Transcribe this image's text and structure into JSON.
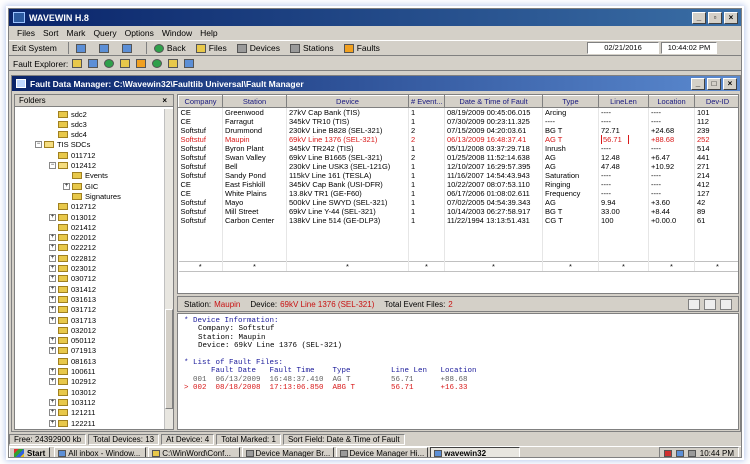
{
  "app": {
    "title": "WAVEWIN H.8"
  },
  "menu": [
    "Files",
    "Sort",
    "Mark",
    "Query",
    "Options",
    "Window",
    "Help"
  ],
  "toolbar": {
    "exit_label": "Exit System",
    "back_label": "Back",
    "files_label": "Files",
    "devices_label": "Devices",
    "stations_label": "Stations",
    "faults_label": "Faults",
    "date": "02/21/2016",
    "time": "10:44:02 PM"
  },
  "fault_explorer": {
    "label": "Fault Explorer:"
  },
  "child": {
    "title": "Fault Data Manager: C:\\Wavewin32\\Faultlib Universal\\Fault Manager"
  },
  "folders": {
    "title": "Folders",
    "items": [
      "sdc2",
      "sdc3",
      "sdc4",
      "TIS SDCs",
      "011712",
      "012412",
      "Events",
      "GIC",
      "Signatures",
      "012712",
      "013012",
      "021412",
      "022012",
      "022212",
      "022812",
      "023012",
      "030712",
      "031412",
      "031613",
      "031712",
      "031713",
      "032012",
      "050112",
      "071913",
      "081613",
      "100611",
      "102912",
      "103012",
      "103112",
      "121211",
      "122211"
    ]
  },
  "table": {
    "columns": [
      "Company",
      "Station",
      "Device",
      "# Event...",
      "Date & Time of Fault",
      "Type",
      "LineLen",
      "Location",
      "Dev-ID"
    ],
    "rows": [
      [
        "CE",
        "Greenwood",
        "27kV Cap Bank (TIS)",
        "1",
        "08/19/2009  00:45:06.015",
        "Arcing",
        "----",
        "----",
        "101"
      ],
      [
        "CE",
        "Farragut",
        "345kV TR10 (TIS)",
        "1",
        "07/30/2009  00:23:11.325",
        "----",
        "----",
        "----",
        "112"
      ],
      [
        "Softstuf",
        "Drummond",
        "230kV Line B828 (SEL-321)",
        "2",
        "07/15/2009  04:20:03.61",
        "BG T",
        "72.71",
        "+24.68",
        "239"
      ],
      [
        "Softstuf",
        "Maupin",
        "69kV Line 1376 (SEL-321)",
        "2",
        "06/13/2009  16:48:37.41",
        "AG T",
        "56.71",
        "+88.68",
        "252"
      ],
      [
        "Softstuf",
        "Byron Plant",
        "345kV TR242 (TIS)",
        "1",
        "05/11/2008  03:37:29.718",
        "Inrush",
        "----",
        "----",
        "514"
      ],
      [
        "Softstuf",
        "Swan Valley",
        "69kV Line B1665 (SEL-321)",
        "2",
        "01/25/2008  11:52:14.638",
        "AG",
        "12.48",
        "+6.47",
        "441"
      ],
      [
        "Softstuf",
        "Bell",
        "230kV Line USK3 (SEL-121G)",
        "1",
        "12/10/2007  16:29:57.395",
        "AG",
        "47.48",
        "+10.92",
        "271"
      ],
      [
        "Softstuf",
        "Sandy Pond",
        "115kV Line 161 (TESLA)",
        "1",
        "11/16/2007  14:54:43.943",
        "Saturation",
        "----",
        "----",
        "214"
      ],
      [
        "CE",
        "East Fishkill",
        "345kV Cap Bank (USI-DFR)",
        "1",
        "10/22/2007  08:07:53.110",
        "Ringing",
        "----",
        "----",
        "412"
      ],
      [
        "CE",
        "White Plains",
        "13.8kV TR1 (GE-F60)",
        "1",
        "06/17/2006  01:08:02.611",
        "Frequency",
        "----",
        "----",
        "127"
      ],
      [
        "Softstuf",
        "Mayo",
        "500kV Line SWYD (SEL-321)",
        "1",
        "07/02/2005  04:54:39.343",
        "AG",
        "9.94",
        "+3.60",
        "42"
      ],
      [
        "Softstuf",
        "Mill Street",
        "69kV Line Y-44 (SEL-321)",
        "1",
        "10/14/2003  06:27:58.917",
        "BG T",
        "33.00",
        "+8.44",
        "89"
      ],
      [
        "Softstuf",
        "Carbon Center",
        "138kV Line 514 (GE-DLP3)",
        "1",
        "11/22/1994  13:13:51.431",
        "CG T",
        "100",
        "+0.00.0",
        "61"
      ]
    ],
    "filter_symbol": "*"
  },
  "detail_bar": {
    "station_label": "Station:",
    "station_value": "Maupin",
    "device_label": "Device:",
    "device_value": "69kV Line 1376 (SEL-321)",
    "files_label": "Total Event Files:",
    "files_value": "2"
  },
  "detail": {
    "device_info_header": "* Device Information:",
    "company_line": "Company: Softstuf",
    "station_line": "Station: Maupin",
    "device_line": "Device: 69kV Line 1376 (SEL-321)",
    "fault_files_header": "* List of Fault Files:",
    "files_header": "      Fault Date   Fault Time    Type         Line Len   Location",
    "file1": "  001  06/13/2009  16:48:37.410  AG T         56.71      +88.68",
    "file2": "> 002  08/18/2008  17:13:06.850  ABG T        56.71      +16.33"
  },
  "status": {
    "free": "Free:   24392900 kb",
    "total_devices": "Total Devices:    13",
    "at_device": "At Device:    4",
    "total_marked": "Total Marked:    1",
    "sort_field": "Sort Field:    Date & Time of Fault"
  },
  "taskbar": {
    "start": "Start",
    "tasks": [
      "All inbox - Window...",
      "C:\\WinWord\\Conf...",
      "Device Manager Br...",
      "Device Manager Hi...",
      "wavewin32"
    ],
    "clock": "10:44 PM"
  }
}
